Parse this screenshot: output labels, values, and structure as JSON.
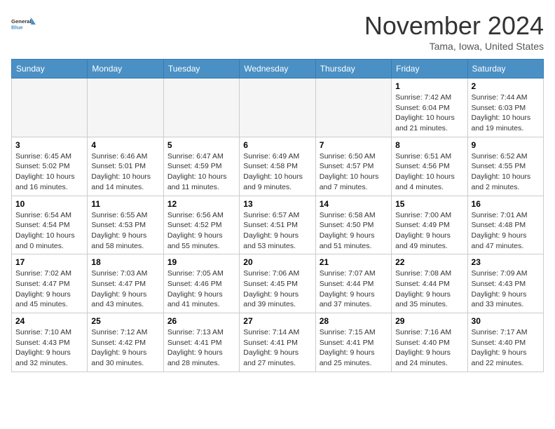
{
  "header": {
    "logo_line1": "General",
    "logo_line2": "Blue",
    "month": "November 2024",
    "location": "Tama, Iowa, United States"
  },
  "weekdays": [
    "Sunday",
    "Monday",
    "Tuesday",
    "Wednesday",
    "Thursday",
    "Friday",
    "Saturday"
  ],
  "weeks": [
    [
      {
        "day": "",
        "info": ""
      },
      {
        "day": "",
        "info": ""
      },
      {
        "day": "",
        "info": ""
      },
      {
        "day": "",
        "info": ""
      },
      {
        "day": "",
        "info": ""
      },
      {
        "day": "1",
        "info": "Sunrise: 7:42 AM\nSunset: 6:04 PM\nDaylight: 10 hours\nand 21 minutes."
      },
      {
        "day": "2",
        "info": "Sunrise: 7:44 AM\nSunset: 6:03 PM\nDaylight: 10 hours\nand 19 minutes."
      }
    ],
    [
      {
        "day": "3",
        "info": "Sunrise: 6:45 AM\nSunset: 5:02 PM\nDaylight: 10 hours\nand 16 minutes."
      },
      {
        "day": "4",
        "info": "Sunrise: 6:46 AM\nSunset: 5:01 PM\nDaylight: 10 hours\nand 14 minutes."
      },
      {
        "day": "5",
        "info": "Sunrise: 6:47 AM\nSunset: 4:59 PM\nDaylight: 10 hours\nand 11 minutes."
      },
      {
        "day": "6",
        "info": "Sunrise: 6:49 AM\nSunset: 4:58 PM\nDaylight: 10 hours\nand 9 minutes."
      },
      {
        "day": "7",
        "info": "Sunrise: 6:50 AM\nSunset: 4:57 PM\nDaylight: 10 hours\nand 7 minutes."
      },
      {
        "day": "8",
        "info": "Sunrise: 6:51 AM\nSunset: 4:56 PM\nDaylight: 10 hours\nand 4 minutes."
      },
      {
        "day": "9",
        "info": "Sunrise: 6:52 AM\nSunset: 4:55 PM\nDaylight: 10 hours\nand 2 minutes."
      }
    ],
    [
      {
        "day": "10",
        "info": "Sunrise: 6:54 AM\nSunset: 4:54 PM\nDaylight: 10 hours\nand 0 minutes."
      },
      {
        "day": "11",
        "info": "Sunrise: 6:55 AM\nSunset: 4:53 PM\nDaylight: 9 hours\nand 58 minutes."
      },
      {
        "day": "12",
        "info": "Sunrise: 6:56 AM\nSunset: 4:52 PM\nDaylight: 9 hours\nand 55 minutes."
      },
      {
        "day": "13",
        "info": "Sunrise: 6:57 AM\nSunset: 4:51 PM\nDaylight: 9 hours\nand 53 minutes."
      },
      {
        "day": "14",
        "info": "Sunrise: 6:58 AM\nSunset: 4:50 PM\nDaylight: 9 hours\nand 51 minutes."
      },
      {
        "day": "15",
        "info": "Sunrise: 7:00 AM\nSunset: 4:49 PM\nDaylight: 9 hours\nand 49 minutes."
      },
      {
        "day": "16",
        "info": "Sunrise: 7:01 AM\nSunset: 4:48 PM\nDaylight: 9 hours\nand 47 minutes."
      }
    ],
    [
      {
        "day": "17",
        "info": "Sunrise: 7:02 AM\nSunset: 4:47 PM\nDaylight: 9 hours\nand 45 minutes."
      },
      {
        "day": "18",
        "info": "Sunrise: 7:03 AM\nSunset: 4:47 PM\nDaylight: 9 hours\nand 43 minutes."
      },
      {
        "day": "19",
        "info": "Sunrise: 7:05 AM\nSunset: 4:46 PM\nDaylight: 9 hours\nand 41 minutes."
      },
      {
        "day": "20",
        "info": "Sunrise: 7:06 AM\nSunset: 4:45 PM\nDaylight: 9 hours\nand 39 minutes."
      },
      {
        "day": "21",
        "info": "Sunrise: 7:07 AM\nSunset: 4:44 PM\nDaylight: 9 hours\nand 37 minutes."
      },
      {
        "day": "22",
        "info": "Sunrise: 7:08 AM\nSunset: 4:44 PM\nDaylight: 9 hours\nand 35 minutes."
      },
      {
        "day": "23",
        "info": "Sunrise: 7:09 AM\nSunset: 4:43 PM\nDaylight: 9 hours\nand 33 minutes."
      }
    ],
    [
      {
        "day": "24",
        "info": "Sunrise: 7:10 AM\nSunset: 4:43 PM\nDaylight: 9 hours\nand 32 minutes."
      },
      {
        "day": "25",
        "info": "Sunrise: 7:12 AM\nSunset: 4:42 PM\nDaylight: 9 hours\nand 30 minutes."
      },
      {
        "day": "26",
        "info": "Sunrise: 7:13 AM\nSunset: 4:41 PM\nDaylight: 9 hours\nand 28 minutes."
      },
      {
        "day": "27",
        "info": "Sunrise: 7:14 AM\nSunset: 4:41 PM\nDaylight: 9 hours\nand 27 minutes."
      },
      {
        "day": "28",
        "info": "Sunrise: 7:15 AM\nSunset: 4:41 PM\nDaylight: 9 hours\nand 25 minutes."
      },
      {
        "day": "29",
        "info": "Sunrise: 7:16 AM\nSunset: 4:40 PM\nDaylight: 9 hours\nand 24 minutes."
      },
      {
        "day": "30",
        "info": "Sunrise: 7:17 AM\nSunset: 4:40 PM\nDaylight: 9 hours\nand 22 minutes."
      }
    ]
  ]
}
